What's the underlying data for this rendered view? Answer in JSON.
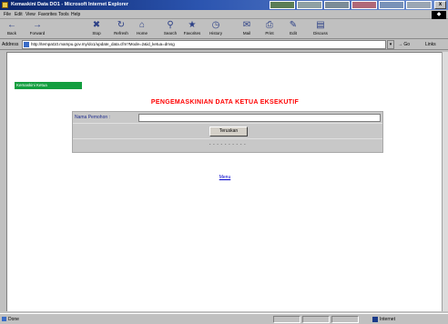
{
  "window": {
    "title": "Kemaskini Data DO1 - Microsoft Internet Explorer",
    "close_label": "x"
  },
  "menubar": {
    "items": [
      "File",
      "Edit",
      "View",
      "Favorites",
      "Tools",
      "Help"
    ]
  },
  "toolbar": {
    "buttons": [
      {
        "label": "Back",
        "icon": "back-arrow-icon"
      },
      {
        "label": "Forward",
        "icon": "forward-arrow-icon"
      },
      {
        "label": "Stop",
        "icon": "stop-icon"
      },
      {
        "label": "Refresh",
        "icon": "refresh-icon"
      },
      {
        "label": "Home",
        "icon": "home-icon"
      },
      {
        "label": "Search",
        "icon": "search-icon"
      },
      {
        "label": "Favorites",
        "icon": "favorites-icon"
      },
      {
        "label": "History",
        "icon": "history-icon"
      },
      {
        "label": "Mail",
        "icon": "mail-icon"
      },
      {
        "label": "Print",
        "icon": "print-icon"
      },
      {
        "label": "Edit",
        "icon": "edit-icon"
      },
      {
        "label": "Discuss",
        "icon": "discuss-icon"
      }
    ]
  },
  "addressbar": {
    "label": "Address",
    "url": "http://tempat10.mampu.gov.my/do1/update_data.cfm?Mode=2&id_ketua=dmsg",
    "go_label": "Go",
    "links_label": "Links"
  },
  "page": {
    "badge": "Kemaskini Ketua",
    "heading": "PENGEMASKINIAN DATA KETUA EKSEKUTIF",
    "form": {
      "field_label": "Nama Pemohon :",
      "field_value": "",
      "submit_label": "Teruskan",
      "footer_dots": "- - - - - - - - - -"
    },
    "menu_link": "Menu"
  },
  "statusbar": {
    "status_text": "Done",
    "zone_text": "Internet"
  }
}
